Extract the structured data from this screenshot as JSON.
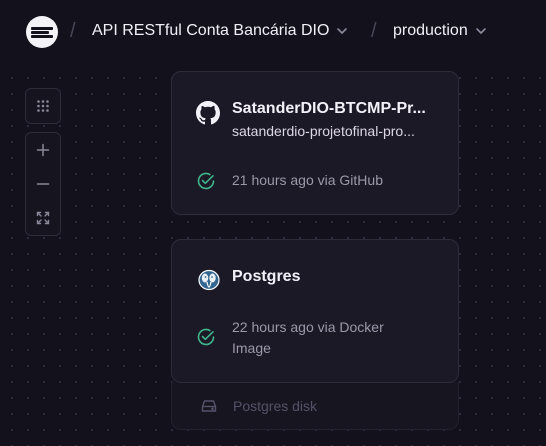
{
  "breadcrumb": {
    "project": "API RESTful Conta Bancária DIO",
    "environment": "production",
    "separator": "/"
  },
  "canvas_controls": {
    "items": [
      {
        "name": "grid-icon"
      },
      {
        "name": "zoom-in-icon"
      },
      {
        "name": "zoom-out-icon"
      },
      {
        "name": "fit-view-icon"
      }
    ]
  },
  "services": [
    {
      "title": "SatanderDIO-BTCMP-Pr...",
      "subtitle": "satanderdio-projetofinal-pro...",
      "icon": "github-icon",
      "status": "21 hours ago via GitHub",
      "status_icon": "check-circle-icon"
    },
    {
      "title": "Postgres",
      "subtitle": "",
      "icon": "postgres-icon",
      "status": "22 hours ago via Docker Image",
      "status_icon": "check-circle-icon",
      "volume": "Postgres disk"
    }
  ],
  "colors": {
    "background": "#13111c",
    "card": "#1b1926",
    "success": "#3fb68b"
  }
}
